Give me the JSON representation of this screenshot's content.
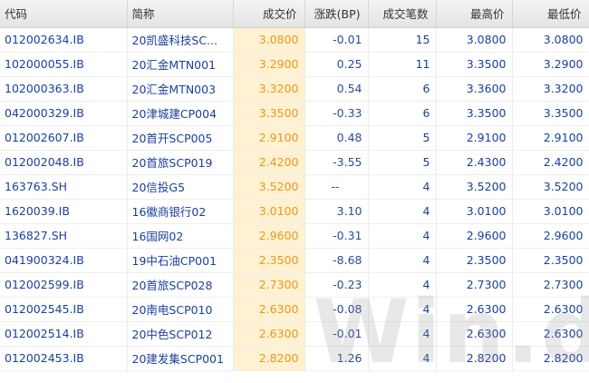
{
  "columns": {
    "code": "代码",
    "name": "简称",
    "price": "成交价",
    "change": "涨跌(BP)",
    "count": "成交笔数",
    "high": "最高价",
    "low": "最低价"
  },
  "rows": [
    {
      "code": "012002634.IB",
      "name": "20凯盛科技SC...",
      "price": "3.0800",
      "change": "-0.01",
      "count": "15",
      "high": "3.0800",
      "low": "3.0800"
    },
    {
      "code": "102000055.IB",
      "name": "20汇金MTN001",
      "price": "3.2900",
      "change": "0.25",
      "count": "11",
      "high": "3.3500",
      "low": "3.2900"
    },
    {
      "code": "102000363.IB",
      "name": "20汇金MTN003",
      "price": "3.3200",
      "change": "0.54",
      "count": "6",
      "high": "3.3600",
      "low": "3.3200"
    },
    {
      "code": "042000329.IB",
      "name": "20津城建CP004",
      "price": "3.3500",
      "change": "-0.33",
      "count": "6",
      "high": "3.3500",
      "low": "3.3500"
    },
    {
      "code": "012002607.IB",
      "name": "20首开SCP005",
      "price": "2.9100",
      "change": "0.48",
      "count": "5",
      "high": "2.9100",
      "low": "2.9100"
    },
    {
      "code": "012002048.IB",
      "name": "20首旅SCP019",
      "price": "2.4200",
      "change": "-3.55",
      "count": "5",
      "high": "2.4300",
      "low": "2.4200"
    },
    {
      "code": "163763.SH",
      "name": "20信投G5",
      "price": "3.5200",
      "change": "--",
      "count": "4",
      "high": "3.5200",
      "low": "3.5200"
    },
    {
      "code": "1620039.IB",
      "name": "16徽商银行02",
      "price": "3.0100",
      "change": "3.10",
      "count": "4",
      "high": "3.0100",
      "low": "3.0100"
    },
    {
      "code": "136827.SH",
      "name": "16国网02",
      "price": "2.9600",
      "change": "-0.31",
      "count": "4",
      "high": "2.9600",
      "low": "2.9600"
    },
    {
      "code": "041900324.IB",
      "name": "19中石油CP001",
      "price": "2.3500",
      "change": "-8.68",
      "count": "4",
      "high": "2.3500",
      "low": "2.3500"
    },
    {
      "code": "012002599.IB",
      "name": "20首旅SCP028",
      "price": "2.7300",
      "change": "-0.23",
      "count": "4",
      "high": "2.7300",
      "low": "2.7300"
    },
    {
      "code": "012002545.IB",
      "name": "20南电SCP010",
      "price": "2.6300",
      "change": "-0.08",
      "count": "4",
      "high": "2.6300",
      "low": "2.6300"
    },
    {
      "code": "012002514.IB",
      "name": "20中色SCP012",
      "price": "2.6300",
      "change": "-0.01",
      "count": "4",
      "high": "2.6300",
      "low": "2.6300"
    },
    {
      "code": "012002453.IB",
      "name": "20建发集SCP001",
      "price": "2.8200",
      "change": "1.26",
      "count": "4",
      "high": "2.8200",
      "low": "2.8200"
    }
  ],
  "watermark": "Win.d",
  "colors": {
    "link_text": "#1a3f9e",
    "price_text": "#e8991a",
    "price_bg": "#fff1d2",
    "header_bg": "#ebebeb"
  }
}
